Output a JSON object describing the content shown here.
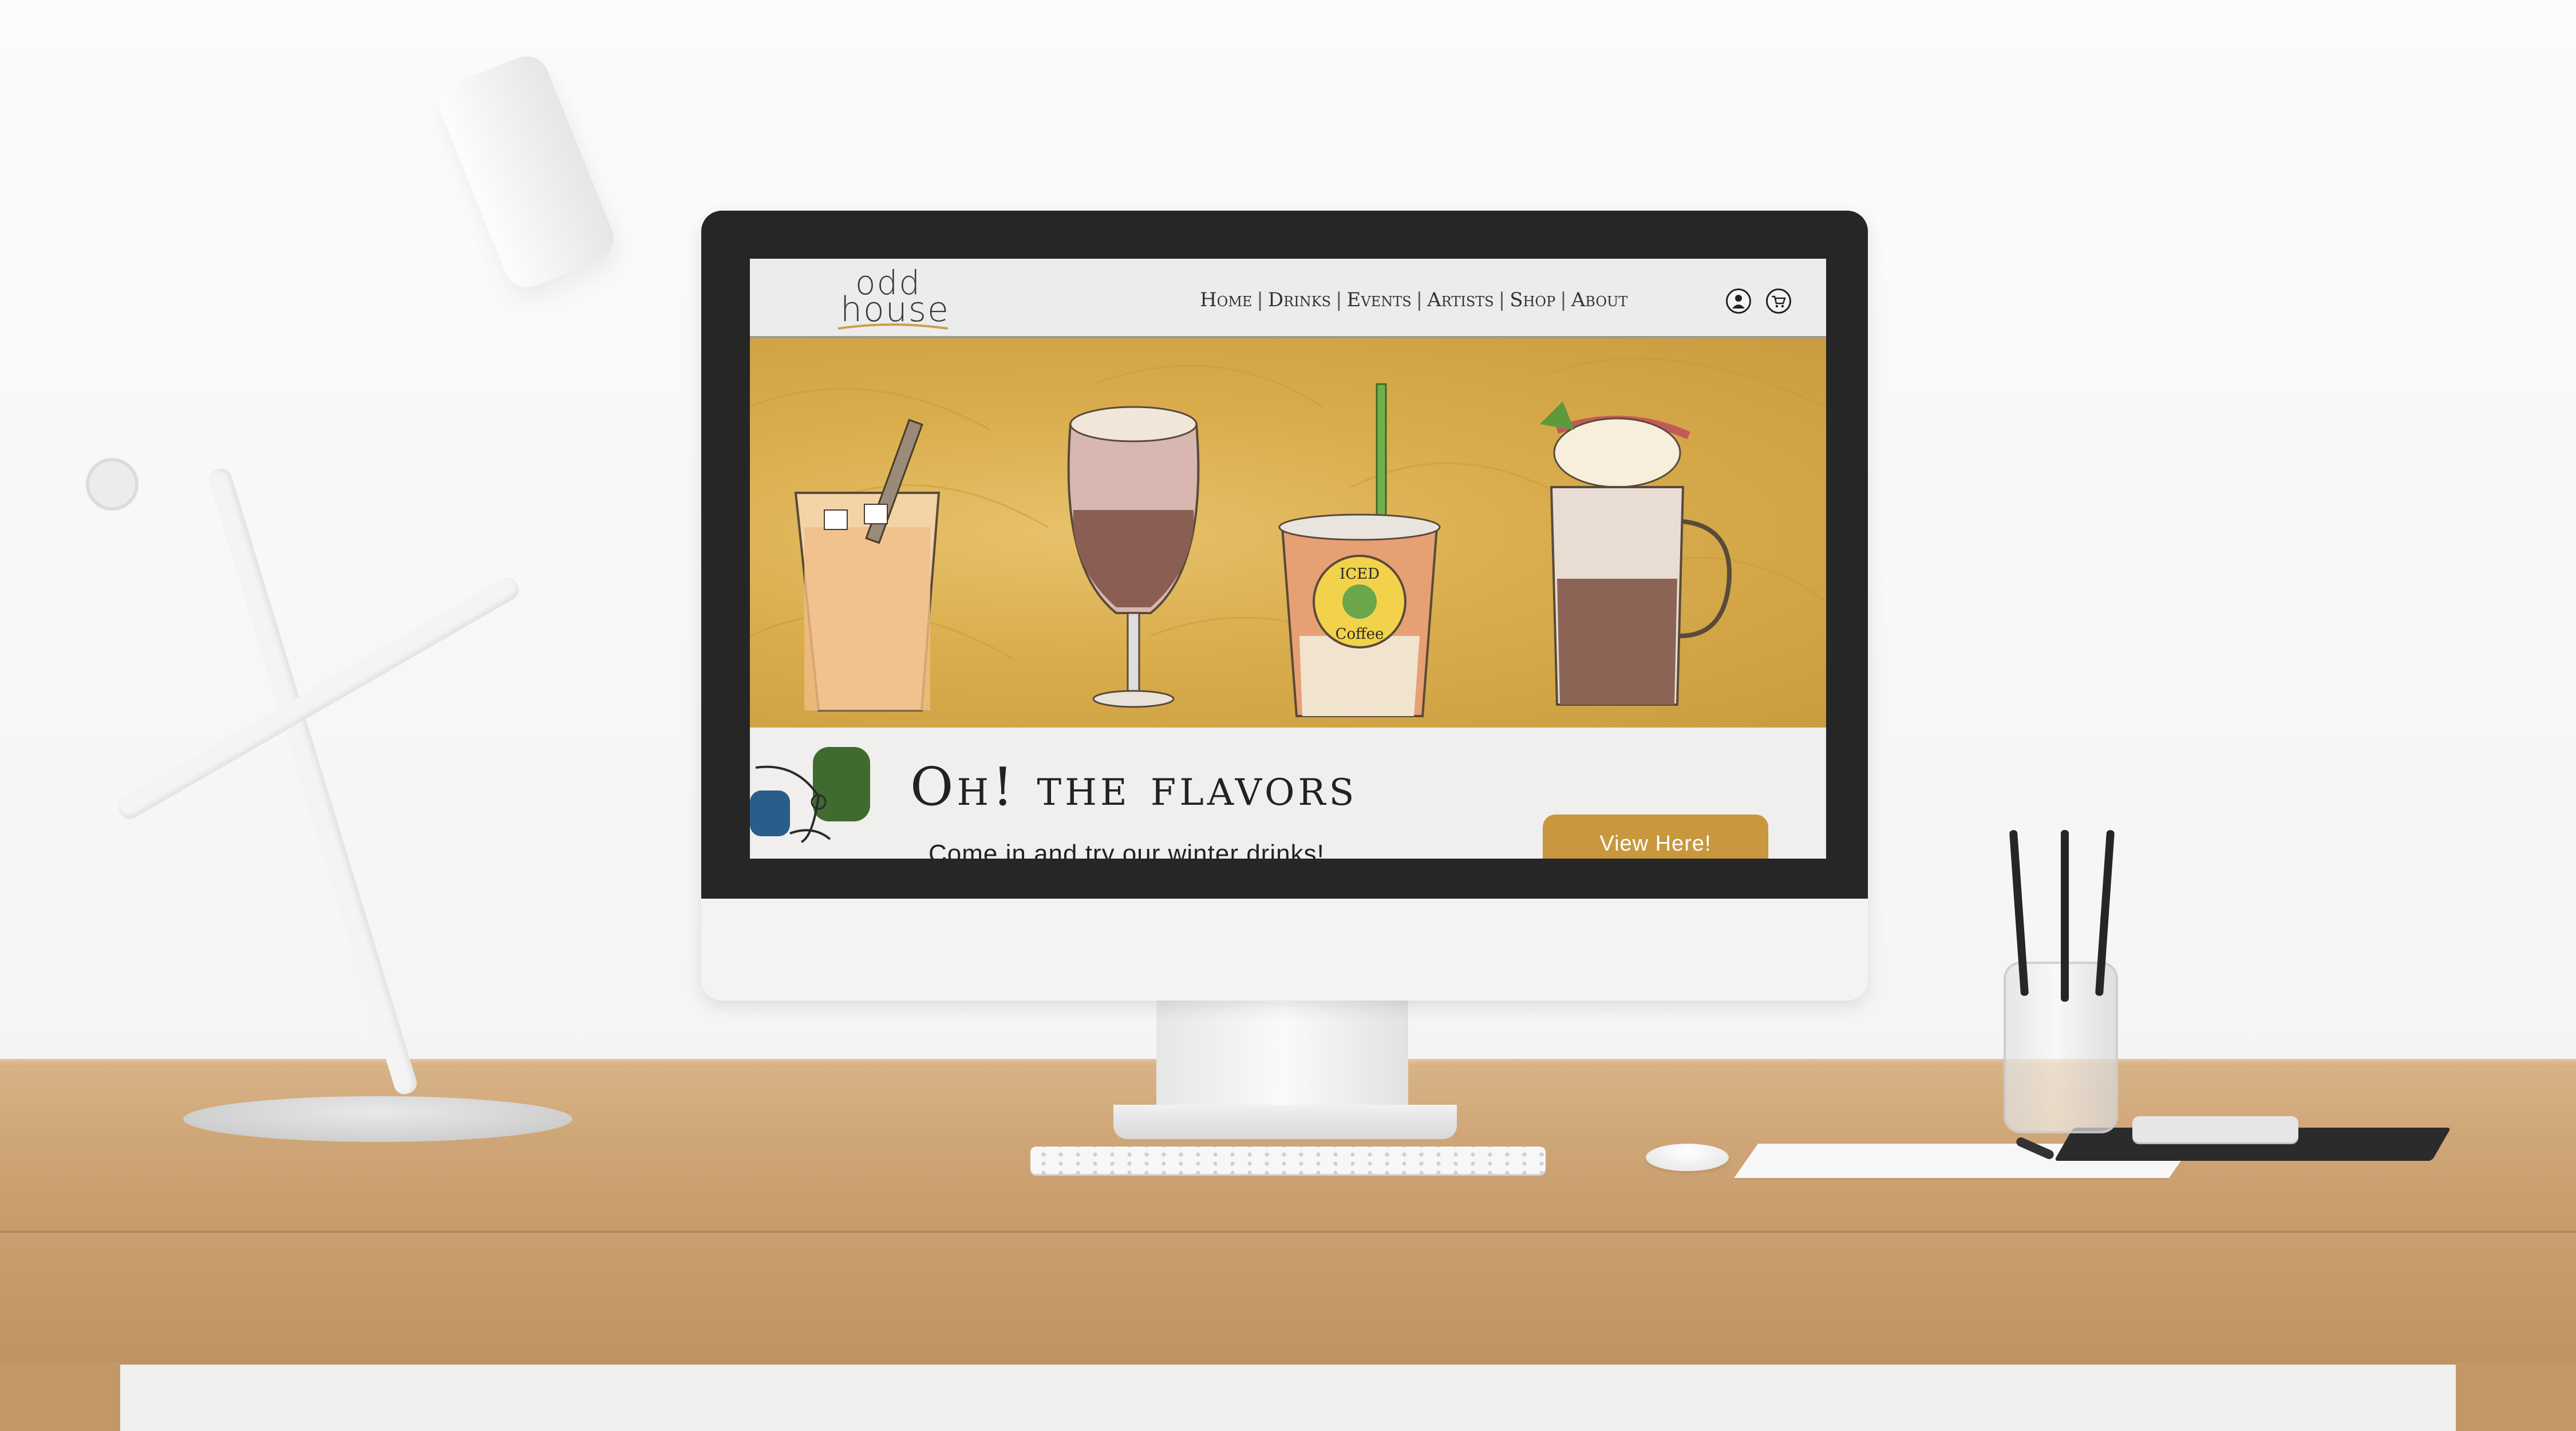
{
  "site": {
    "logo": {
      "line1": "odd",
      "line2": "house"
    },
    "nav": {
      "links": [
        "Home",
        "Drinks",
        "Events",
        "Artists",
        "Shop",
        "About"
      ],
      "separator": "|",
      "icons": [
        "account-icon",
        "cart-icon"
      ]
    },
    "hero": {
      "cup_label_top": "ICED",
      "cup_label_bottom": "Coffee"
    },
    "band": {
      "headline": "Oh! the flavors",
      "subline": "Come in and try our winter drinks!",
      "cta_label": "View Here!"
    }
  },
  "colors": {
    "hero_gold": "#d9ad4c",
    "cta_gold": "#c8973e",
    "nav_bg": "#ececec",
    "band_bg": "#f0efed",
    "face_blue": "#2a5d8a",
    "face_green": "#3f6b2f",
    "desk_wood": "#cfa677"
  }
}
